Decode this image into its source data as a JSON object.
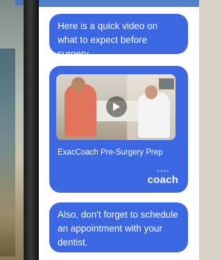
{
  "messages": [
    {
      "text": "Here is a quick video on what to expect before surgery."
    },
    {
      "video": {
        "title": "ExacCoach Pre-Surgery Prep",
        "logo_text": "coach",
        "logo_small": "exac"
      }
    },
    {
      "text": "Also, don't forget to schedule an appointment with your dentist."
    }
  ],
  "colors": {
    "bubble": "#3b67e3",
    "screen_bg": "#ffffff",
    "topbar": "#4f82c9"
  }
}
